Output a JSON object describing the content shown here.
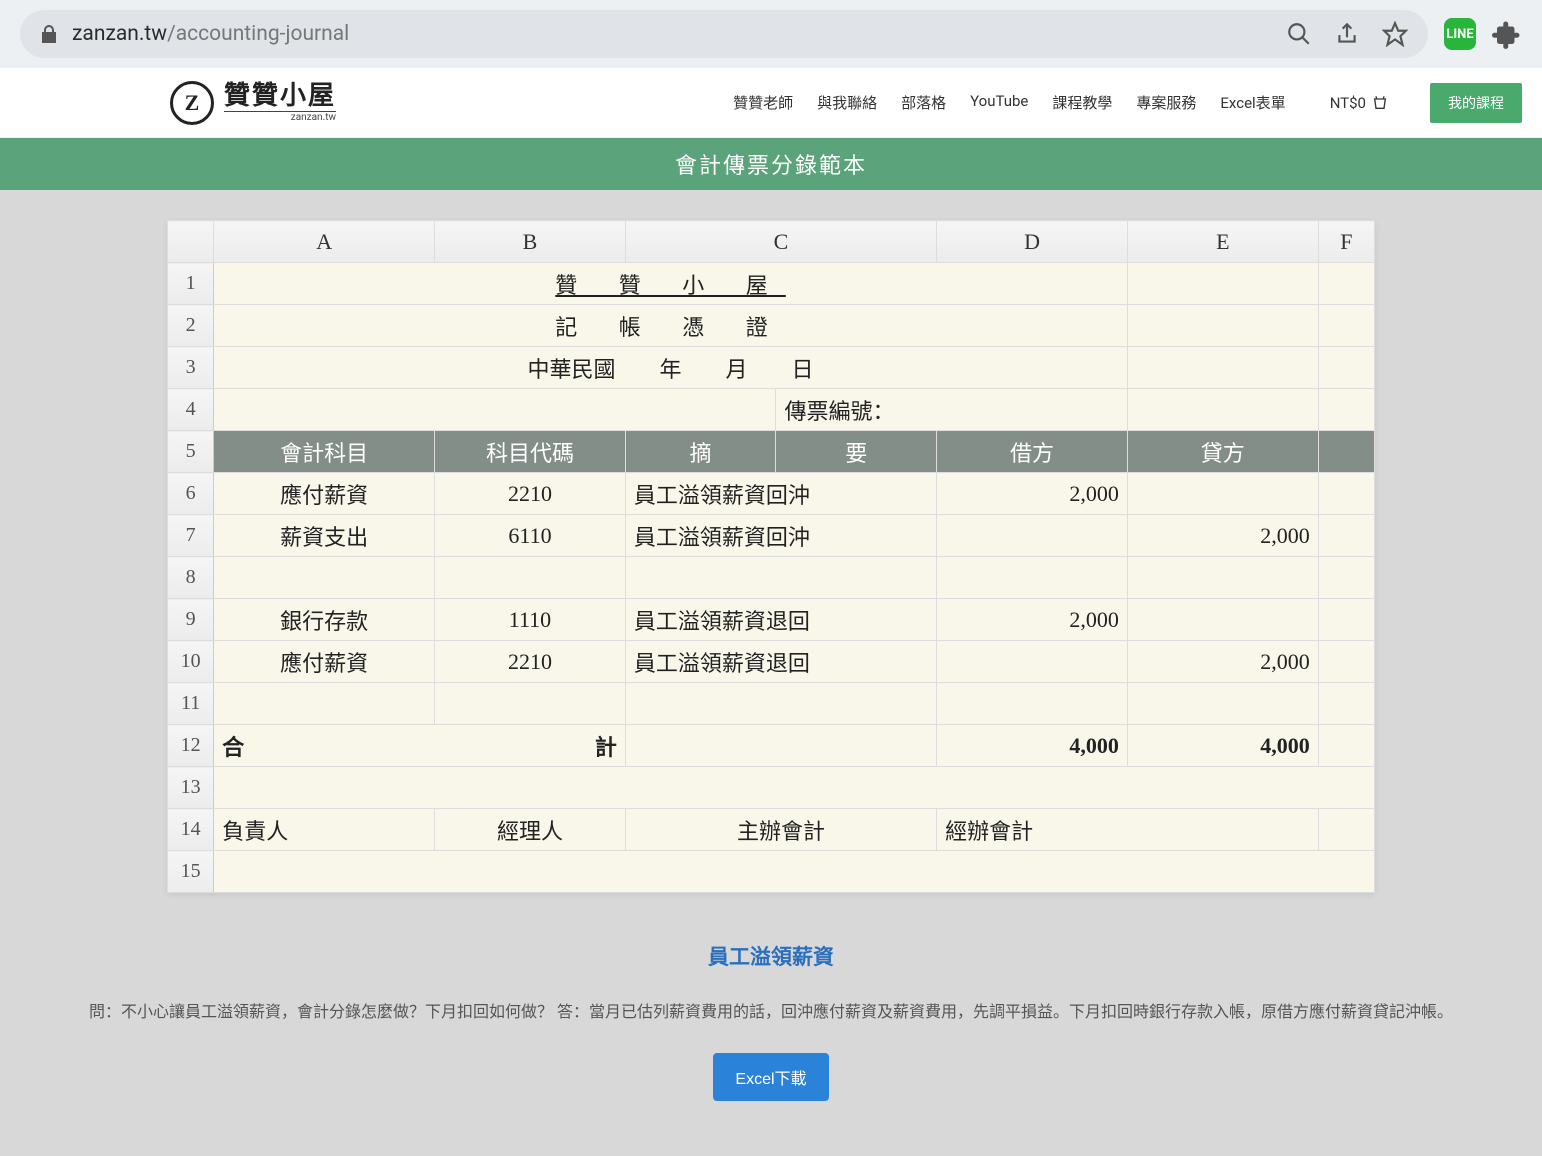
{
  "browser": {
    "domain": "zanzan.tw",
    "path": "/accounting-journal",
    "ext_label": "LINE"
  },
  "header": {
    "logo_main": "贊贊小屋",
    "logo_sub": "zanzan.tw",
    "nav": [
      "贊贊老師",
      "與我聯絡",
      "部落格",
      "YouTube",
      "課程教學",
      "專案服務",
      "Excel表單"
    ],
    "cart_label": "NT$0",
    "my_courses": "我的課程"
  },
  "title_bar": "會計傳票分錄範本",
  "sheet": {
    "columns": [
      "A",
      "B",
      "C",
      "D",
      "E",
      "F"
    ],
    "rows": [
      "1",
      "2",
      "3",
      "4",
      "5",
      "6",
      "7",
      "8",
      "9",
      "10",
      "11",
      "12",
      "13",
      "14",
      "15"
    ],
    "r1_title": "贊 贊 小 屋",
    "r2_subtitle": "記 帳 憑 證",
    "r3_date": "中華民國　　年　　月　　日",
    "r4_voucher": "傳票編號：",
    "hdr": {
      "a": "會計科目",
      "b": "科目代碼",
      "c": "摘",
      "c2": "要",
      "d": "借方",
      "e": "貸方"
    },
    "entries": [
      {
        "account": "應付薪資",
        "code": "2210",
        "desc": "員工溢領薪資回沖",
        "debit": "2,000",
        "credit": ""
      },
      {
        "account": "薪資支出",
        "code": "6110",
        "desc": "員工溢領薪資回沖",
        "debit": "",
        "credit": "2,000"
      },
      {
        "account": "",
        "code": "",
        "desc": "",
        "debit": "",
        "credit": ""
      },
      {
        "account": "銀行存款",
        "code": "1110",
        "desc": "員工溢領薪資退回",
        "debit": "2,000",
        "credit": ""
      },
      {
        "account": "應付薪資",
        "code": "2210",
        "desc": "員工溢領薪資退回",
        "debit": "",
        "credit": "2,000"
      },
      {
        "account": "",
        "code": "",
        "desc": "",
        "debit": "",
        "credit": ""
      }
    ],
    "total_label": "合　　　　計",
    "total_debit": "4,000",
    "total_credit": "4,000",
    "sig": {
      "a": "負責人",
      "b": "經理人",
      "c": "主辦會計",
      "d": "經辦會計"
    }
  },
  "article": {
    "title": "員工溢領薪資",
    "body": "問：不小心讓員工溢領薪資，會計分錄怎麼做？下月扣回如何做？ 答：當月已估列薪資費用的話，回沖應付薪資及薪資費用，先調平損益。下月扣回時銀行存款入帳，原借方應付薪資貸記沖帳。",
    "download": "Excel下載"
  }
}
